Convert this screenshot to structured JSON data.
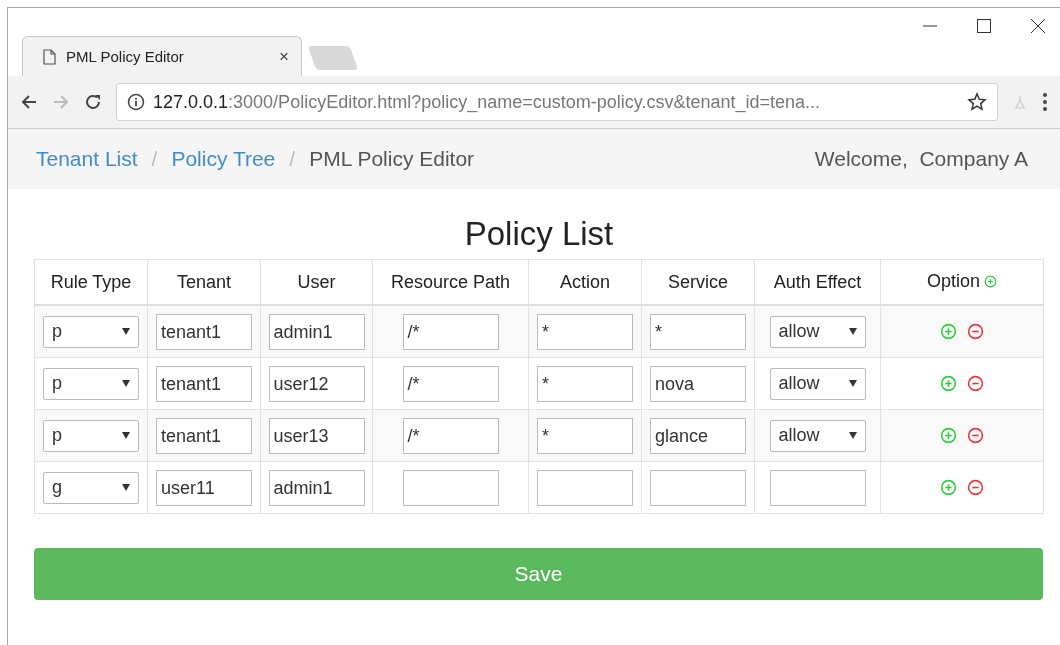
{
  "browser": {
    "tab_title": "PML Policy Editor",
    "tab_close": "×",
    "url": {
      "host": "127.0.0.1",
      "rest": ":3000/PolicyEditor.html?policy_name=custom-policy.csv&tenant_id=tena..."
    }
  },
  "breadcrumb": [
    {
      "label": "Tenant List",
      "kind": "link"
    },
    {
      "label": "Policy Tree",
      "kind": "link"
    },
    {
      "label": "PML Policy Editor",
      "kind": "current"
    }
  ],
  "breadcrumb_separator": "/",
  "welcome": "Welcome,  Company A",
  "title": "Policy List",
  "table": {
    "columns": [
      "Rule Type",
      "Tenant",
      "User",
      "Resource Path",
      "Action",
      "Service",
      "Auth Effect",
      "Option"
    ],
    "rows": [
      {
        "rule_type": "p",
        "tenant": "tenant1",
        "user": "admin1",
        "resource_path": "/*",
        "action": "*",
        "service": "*",
        "auth_effect": {
          "kind": "select",
          "value": "allow"
        }
      },
      {
        "rule_type": "p",
        "tenant": "tenant1",
        "user": "user12",
        "resource_path": "/*",
        "action": "*",
        "service": "nova",
        "auth_effect": {
          "kind": "select",
          "value": "allow"
        }
      },
      {
        "rule_type": "p",
        "tenant": "tenant1",
        "user": "user13",
        "resource_path": "/*",
        "action": "*",
        "service": "glance",
        "auth_effect": {
          "kind": "select",
          "value": "allow"
        }
      },
      {
        "rule_type": "g",
        "tenant": "user11",
        "user": "admin1",
        "auth_effect": {
          "kind": "input"
        }
      }
    ]
  },
  "save_button": "Save"
}
